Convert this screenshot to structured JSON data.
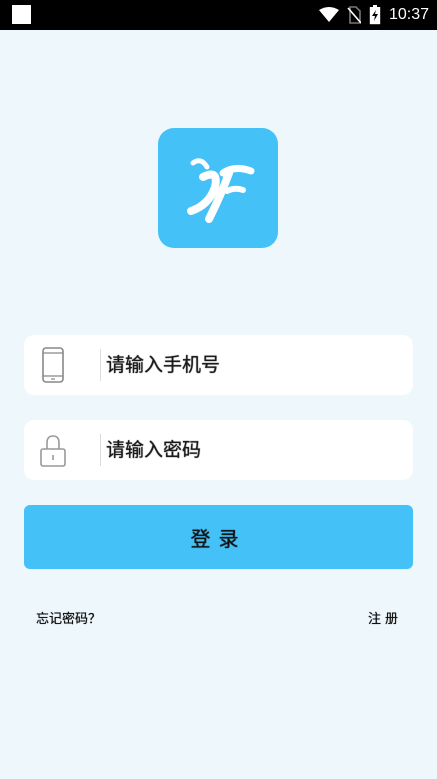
{
  "status_bar": {
    "time": "10:37",
    "icons": [
      "wifi-icon",
      "no-sim-icon",
      "battery-charging-icon"
    ]
  },
  "logo": {
    "icon": "app-logo-icon",
    "color": "#44c1f7"
  },
  "login_form": {
    "phone_placeholder": "请输入手机号",
    "phone_icon": "phone-icon",
    "password_placeholder": "请输入密码",
    "password_icon": "lock-icon",
    "login_label": "登录"
  },
  "links": {
    "forgot_password": "忘记密码？",
    "register": "注册"
  },
  "colors": {
    "accent": "#44c1f7",
    "background": "#eef7fb"
  }
}
